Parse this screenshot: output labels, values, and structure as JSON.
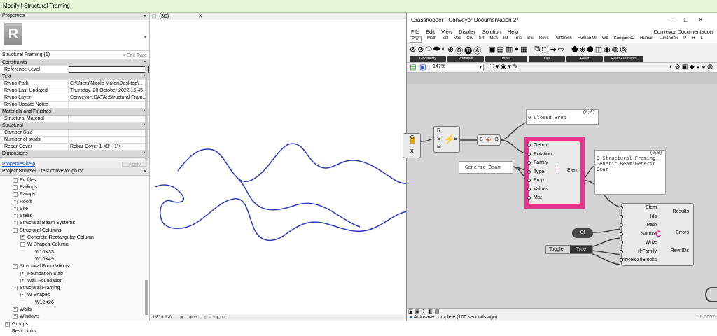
{
  "modify_bar": "Modify | Structural Framing",
  "properties": {
    "header": "Properties",
    "type_selector": "Structural Framing (1)",
    "edit_type": "Edit Type",
    "categories": [
      {
        "label": "Constraints",
        "rows": [
          {
            "k": "Reference Level",
            "v": ""
          }
        ]
      },
      {
        "label": "Text",
        "rows": [
          {
            "k": "Rhino Path",
            "v": "C:\\Users\\Nicole Mater\\Desktop\\..."
          },
          {
            "k": "Rhino Last Updated",
            "v": "Thursday, 20 October 2022 15:45..."
          },
          {
            "k": "Rhino Layer",
            "v": "Conveyor::DATA::Structural Fram..."
          },
          {
            "k": "Rhino Update Notes",
            "v": ""
          }
        ]
      },
      {
        "label": "Materials and Finishes",
        "rows": [
          {
            "k": "Structural Material",
            "v": ""
          }
        ]
      },
      {
        "label": "Structural",
        "rows": [
          {
            "k": "Camber Size",
            "v": ""
          },
          {
            "k": "Number of studs",
            "v": ""
          },
          {
            "k": "Rebar Cover",
            "v": "Rebar Cover 1 <0' - 1\">"
          }
        ]
      },
      {
        "label": "Dimensions",
        "rows": []
      }
    ],
    "help_link": "Properties help",
    "apply": "Apply"
  },
  "browser": {
    "header": "Project Browser - test conveyor gh.rvt",
    "items": [
      {
        "indent": 1,
        "pm": "+",
        "label": "Profiles"
      },
      {
        "indent": 1,
        "pm": "+",
        "label": "Railings"
      },
      {
        "indent": 1,
        "pm": "+",
        "label": "Ramps"
      },
      {
        "indent": 1,
        "pm": "+",
        "label": "Roofs"
      },
      {
        "indent": 1,
        "pm": "+",
        "label": "Site"
      },
      {
        "indent": 1,
        "pm": "+",
        "label": "Stairs"
      },
      {
        "indent": 1,
        "pm": "+",
        "label": "Structural Beam Systems"
      },
      {
        "indent": 1,
        "pm": "-",
        "label": "Structural Columns"
      },
      {
        "indent": 2,
        "pm": "+",
        "label": "Concrete-Rectangular-Column"
      },
      {
        "indent": 2,
        "pm": "-",
        "label": "W Shapes-Column"
      },
      {
        "indent": 3,
        "pm": "",
        "label": "W10X33"
      },
      {
        "indent": 3,
        "pm": "",
        "label": "W10X49"
      },
      {
        "indent": 1,
        "pm": "-",
        "label": "Structural Foundations"
      },
      {
        "indent": 2,
        "pm": "+",
        "label": "Foundation Slab"
      },
      {
        "indent": 2,
        "pm": "+",
        "label": "Wall Foundation"
      },
      {
        "indent": 1,
        "pm": "-",
        "label": "Structural Framing"
      },
      {
        "indent": 2,
        "pm": "-",
        "label": "W Shapes"
      },
      {
        "indent": 3,
        "pm": "",
        "label": "W12X26"
      },
      {
        "indent": 1,
        "pm": "+",
        "label": "Walls"
      },
      {
        "indent": 1,
        "pm": "+",
        "label": "Windows"
      },
      {
        "indent": 0,
        "pm": "+",
        "label": "Groups"
      },
      {
        "indent": 0,
        "pm": "",
        "label": "Revit Links"
      }
    ]
  },
  "view3d": {
    "tab": "{3D}",
    "scale": "1/8\" = 1'-0\""
  },
  "gh": {
    "title": "Grasshopper - Conveyor Documentation 2*",
    "menu": [
      "File",
      "Edit",
      "View",
      "Display",
      "Solution",
      "Help"
    ],
    "doc_name": "Conveyor Documentation",
    "tabs": [
      "Prm",
      "Math",
      "Set",
      "Vec",
      "Crv",
      "Srf",
      "Msh",
      "Int",
      "Trns",
      "Dis",
      "Revit",
      "Pufferfish",
      "Human UI",
      "Wb",
      "Kangaroo2",
      "Human",
      "LunchBox",
      "P",
      "H",
      "L"
    ],
    "groups": [
      "Geometry",
      "Primitive",
      "Input",
      "Util",
      "Revit",
      "Revit Elements"
    ],
    "zoom": "147%",
    "status": "Autosave complete (100 seconds ago)",
    "version": "1.0.0007",
    "nodes": {
      "closed_brep_panel": {
        "count": "{0;0}",
        "text": "0 Closed Brep"
      },
      "generic_beam": "Generic Beam",
      "sf_panel": {
        "count": "{0;0}",
        "text": "0 Structural Framing:\nGeneric Beam:Generic\nBeam"
      },
      "add_inputs": [
        "Geom",
        "Rotation",
        "Family",
        "Type",
        "Prop",
        "Values",
        "Mat"
      ],
      "add_output": "Elem",
      "conv_inputs": [
        "Elem",
        "Ids",
        "Path",
        "Source",
        "Write",
        "rlrFamily",
        "rlrReloadBlocks"
      ],
      "conv_outputs": [
        "Results",
        "Errors",
        "RevitIDs"
      ],
      "toggle_label": "Toggle",
      "toggle_value": "True",
      "b_label": "B",
      "g_label": "G",
      "x_label": "X",
      "rsm": [
        "R",
        "S",
        "M"
      ],
      "s_out": "S",
      "cf": "Cf"
    },
    "highlight_color": "#e8338a"
  }
}
